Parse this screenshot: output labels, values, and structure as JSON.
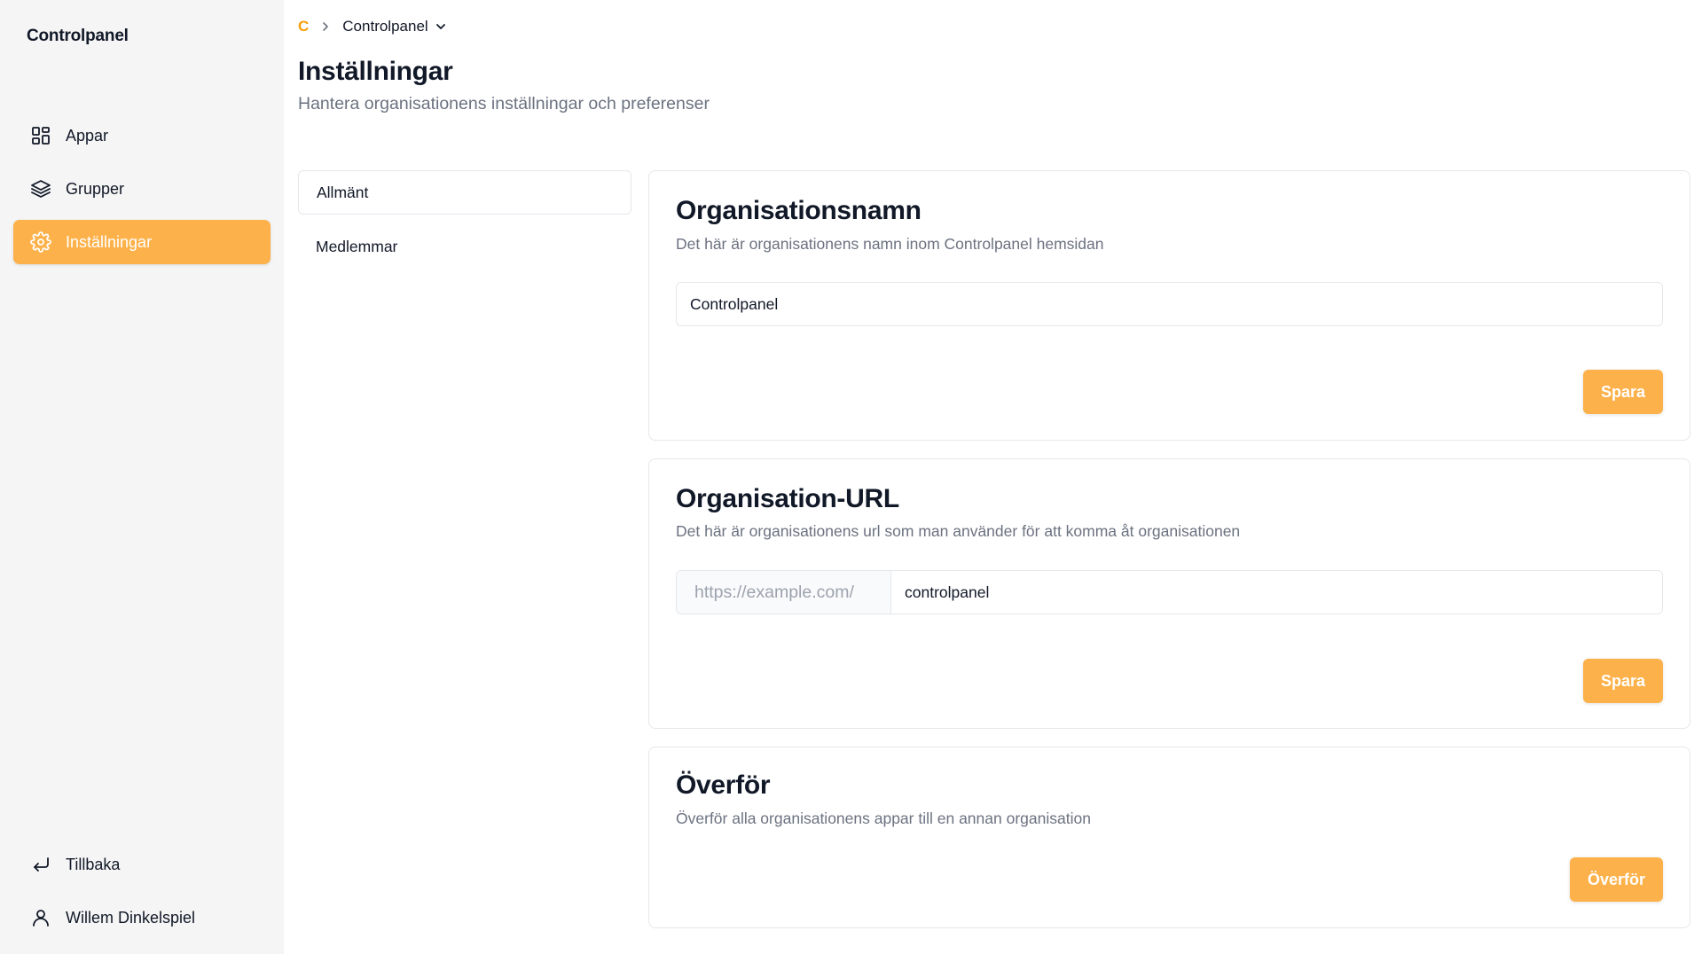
{
  "app": {
    "logo": "Controlpanel"
  },
  "sidebar": {
    "items": [
      {
        "label": "Appar",
        "icon": "apps-grid-icon"
      },
      {
        "label": "Grupper",
        "icon": "layers-icon"
      },
      {
        "label": "Inställningar",
        "icon": "gear-icon",
        "active": true
      }
    ],
    "footer": [
      {
        "label": "Tillbaka",
        "icon": "return-arrow-icon"
      },
      {
        "label": "Willem Dinkelspiel",
        "icon": "user-icon"
      }
    ]
  },
  "breadcrumb": {
    "home": "C",
    "org": "Controlpanel"
  },
  "header": {
    "title": "Inställningar",
    "subtitle": "Hantera organisationens inställningar och preferenser"
  },
  "settings_nav": [
    {
      "label": "Allmänt",
      "active": true
    },
    {
      "label": "Medlemmar"
    }
  ],
  "org_name": {
    "title": "Organisationsnamn",
    "description": "Det här är organisationens namn inom Controlpanel hemsidan",
    "value": "Controlpanel",
    "button": "Spara"
  },
  "org_url": {
    "title": "Organisation-URL",
    "description": "Det här är organisationens url som man använder för att komma åt organisationen",
    "prefix": "https://example.com/",
    "value": "controlpanel",
    "button": "Spara"
  },
  "transfer": {
    "title": "Överför",
    "description": "Överför alla organisationens appar till en annan organisation",
    "button": "Överför"
  },
  "colors": {
    "accent": "#fdb14a",
    "muted": "#6b7280",
    "border": "#e5e7eb",
    "sidebar_bg": "#f5f5f5"
  }
}
